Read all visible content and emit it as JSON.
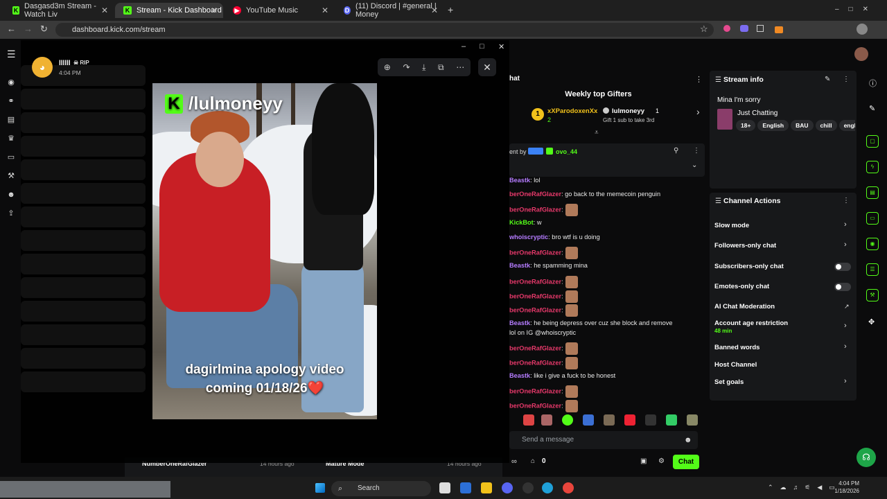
{
  "browser": {
    "tabs": [
      {
        "label": "Dasgasd3m Stream - Watch Liv",
        "color": "#53fc18",
        "icon": "K"
      },
      {
        "label": "Stream - Kick Dashboard",
        "color": "#53fc18",
        "icon": "K"
      },
      {
        "label": "YouTube Music",
        "color": "#ff0033",
        "icon": "▶"
      },
      {
        "label": "(11) Discord | #general | Money",
        "color": "#5865f2",
        "icon": "D"
      }
    ],
    "url": "dashboard.kick.com/stream"
  },
  "discord_viewer": {
    "username": "llllll",
    "badge": "RIP",
    "time": "4:04 PM",
    "image_handle": "/lulmoneyy",
    "caption_line1": "dagirlmina apology video",
    "caption_line2": "coming 01/18/26",
    "heart": "❤️"
  },
  "chat": {
    "gifters_title": "Weekly top Gifters",
    "gifter1_name": "xXParodoxenXx",
    "gifter1_count": "2",
    "gifter2_name": "lulmoneyy",
    "gifter2_count": "1",
    "gift_hint": "Gift 1 sub to take 3rd",
    "pinned_prefix": "ent by",
    "pinned_user": "ovo_44",
    "lines": [
      {
        "user": "Beastk",
        "color": "#b57cff",
        "text": ": lol"
      },
      {
        "user": "berOneRafGlazer",
        "color": "#e8396b",
        "text": ": go back to the memecoin penguin"
      },
      {
        "user": "berOneRafGlazer",
        "color": "#e8396b",
        "text": ":",
        "emote": true
      },
      {
        "user": "KickBot",
        "color": "#53fc18",
        "text": ": w"
      },
      {
        "user": "whoiscryptic",
        "color": "#b57cff",
        "text": ": bro wtf is u doing"
      },
      {
        "user": "berOneRafGlazer",
        "color": "#e8396b",
        "text": ":",
        "emote": true
      },
      {
        "user": "Beastk",
        "color": "#b57cff",
        "text": ": he spamming mina"
      },
      {
        "user": "berOneRafGlazer",
        "color": "#e8396b",
        "text": ":",
        "emote": true
      },
      {
        "user": "berOneRafGlazer",
        "color": "#e8396b",
        "text": ":",
        "emote": true
      },
      {
        "user": "berOneRafGlazer",
        "color": "#e8396b",
        "text": ":",
        "emote": true
      },
      {
        "user": "Beastk",
        "color": "#b57cff",
        "text": ": he being depress over cuz she block and remove"
      },
      {
        "user": "",
        "color": "#e8e8e8",
        "text": "lol on IG @whoiscryptic"
      },
      {
        "user": "berOneRafGlazer",
        "color": "#e8396b",
        "text": ":",
        "emote": true
      },
      {
        "user": "berOneRafGlazer",
        "color": "#e8396b",
        "text": ":",
        "emote": true
      },
      {
        "user": "Beastk",
        "color": "#b57cff",
        "text": ": like i give a fuck to be honest"
      },
      {
        "user": "berOneRafGlazer",
        "color": "#e8396b",
        "text": ":",
        "emote": true
      },
      {
        "user": "berOneRafGlazer",
        "color": "#e8396b",
        "text": ":",
        "emote": true
      }
    ],
    "send_placeholder": "Send a message",
    "points": "0",
    "chat_button": "Chat",
    "header_fragment": "hat"
  },
  "stream_info": {
    "title": "Stream info",
    "stream_title": "Mina I'm sorry",
    "category": "Just Chatting",
    "tags": [
      "18+",
      "English",
      "BAU",
      "chill",
      "engli"
    ]
  },
  "channel_actions": {
    "title": "Channel Actions",
    "items": [
      {
        "label": "Slow mode",
        "control": "chevron"
      },
      {
        "label": "Followers-only chat",
        "control": "chevron"
      },
      {
        "label": "Subscribers-only chat",
        "control": "toggle"
      },
      {
        "label": "Emotes-only chat",
        "control": "toggle"
      },
      {
        "label": "AI Chat Moderation",
        "control": "external"
      },
      {
        "label": "Account age restriction",
        "control": "chevron",
        "sub": "48 min"
      },
      {
        "label": "Banned words",
        "control": "chevron"
      },
      {
        "label": "Host Channel",
        "control": "none"
      },
      {
        "label": "Set goals",
        "control": "chevron"
      }
    ]
  },
  "bottom_cards": {
    "left": "NumberOneRafGlazer",
    "left_time": "14 hours ago",
    "right": "Mature Mode",
    "right_time": "14 hours ago"
  },
  "taskbar": {
    "search": "Search",
    "time": "4:04 PM",
    "date": "1/18/2026"
  }
}
